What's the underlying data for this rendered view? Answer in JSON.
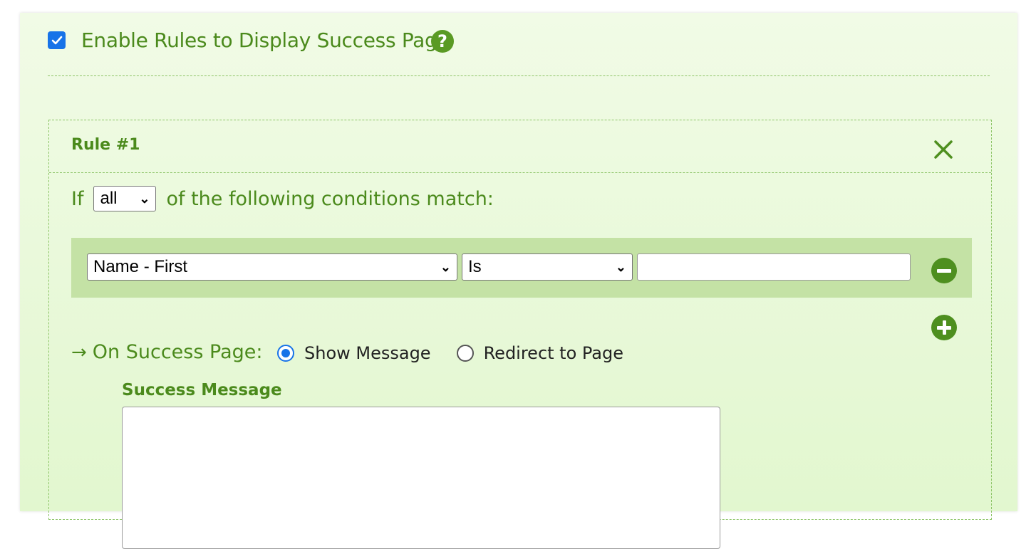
{
  "enable": {
    "label": "Enable Rules to Display Success Page",
    "checked": true,
    "help_icon": "question-circle-icon"
  },
  "rule": {
    "title": "Rule #1",
    "close_icon": "close-icon",
    "if_prefix": "If",
    "match_select": "all",
    "if_suffix": "of the following conditions match:",
    "conditions": [
      {
        "field": "Name - First",
        "operator": "Is",
        "value": ""
      }
    ],
    "success": {
      "label": "On Success Page:",
      "options": [
        "Show Message",
        "Redirect to Page"
      ],
      "selected": "Show Message",
      "message_label": "Success Message",
      "message_value": ""
    }
  },
  "colors": {
    "accent_green": "#4b8a1c",
    "panel_bg": "#e8f8d8",
    "condition_bg": "#c4e2a5",
    "checkbox_blue": "#1773e8"
  }
}
